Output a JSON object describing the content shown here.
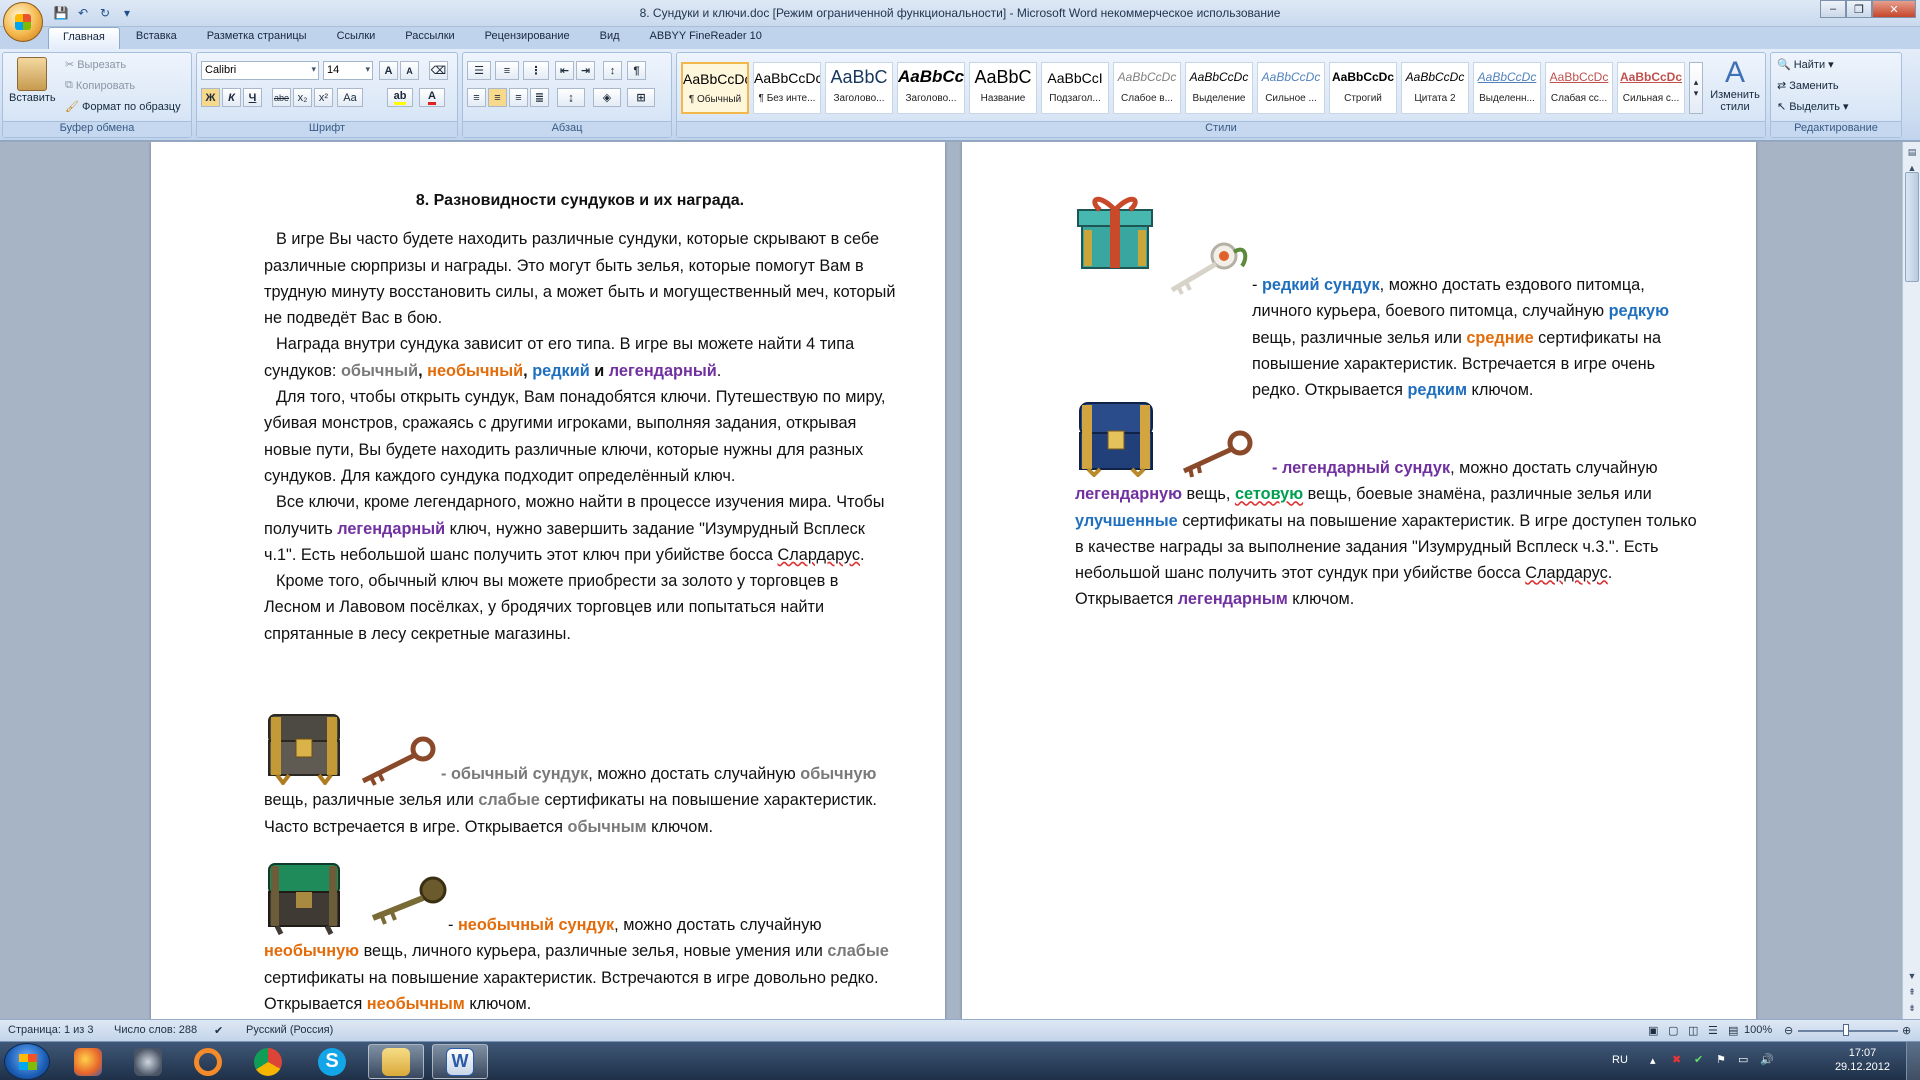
{
  "window": {
    "title": "8. Сундуки и ключи.doc [Режим ограниченной функциональности] - Microsoft Word некоммерческое использование"
  },
  "tabs": [
    "Главная",
    "Вставка",
    "Разметка страницы",
    "Ссылки",
    "Рассылки",
    "Рецензирование",
    "Вид",
    "ABBYY FineReader 10"
  ],
  "ribbon": {
    "clipboard": {
      "label": "Буфер обмена",
      "paste": "Вставить",
      "cut": "Вырезать",
      "copy": "Копировать",
      "format_painter": "Формат по образцу"
    },
    "font": {
      "label": "Шрифт",
      "family": "Calibri",
      "size": "14",
      "bold": "Ж",
      "italic": "К",
      "underline": "Ч",
      "strike": "abe",
      "sub": "x₂",
      "sup": "x²",
      "case": "Aa",
      "grow": "A",
      "shrink": "A"
    },
    "paragraph": {
      "label": "Абзац"
    },
    "styles": {
      "label": "Стили",
      "items": [
        {
          "sample": "AaBbCcDc",
          "name": "¶ Обычный"
        },
        {
          "sample": "AaBbCcDc",
          "name": "¶ Без инте..."
        },
        {
          "sample": "AaBbC",
          "name": "Заголово..."
        },
        {
          "sample": "AaBbCc",
          "name": "Заголово..."
        },
        {
          "sample": "AaBbC",
          "name": "Название"
        },
        {
          "sample": "AaBbCcI",
          "name": "Подзагол..."
        },
        {
          "sample": "AaBbCcDc",
          "name": "Слабое в..."
        },
        {
          "sample": "AaBbCcDc",
          "name": "Выделение"
        },
        {
          "sample": "AaBbCcDc",
          "name": "Сильное ..."
        },
        {
          "sample": "AaBbCcDc",
          "name": "Строгий"
        },
        {
          "sample": "AaBbCcDc",
          "name": "Цитата 2"
        },
        {
          "sample": "AaBbCcDc",
          "name": "Выделенн..."
        },
        {
          "sample": "AaBbCcDc",
          "name": "Слабая сс..."
        },
        {
          "sample": "AaBbCcDc",
          "name": "Сильная с..."
        }
      ],
      "change_styles": "Изменить стили"
    },
    "editing": {
      "label": "Редактирование",
      "find": "Найти",
      "replace": "Заменить",
      "select": "Выделить"
    }
  },
  "doc": {
    "heading": "8. Разновидности сундуков и их награда.",
    "p1": "В игре Вы часто будете находить различные сундуки, которые скрывают в себе различные сюрпризы и награды. Это могут быть зелья, которые помогут Вам в трудную минуту восстановить силы, а может быть и могущественный меч, который не подведёт Вас в бою.",
    "p2_pre": "Награда внутри сундука зависит от его типа. В игре вы можете найти 4 типа сундуков: ",
    "w_common": "обычный",
    "sep_comma": ", ",
    "w_uncommon": "необычный",
    "w_rare": "редкий",
    "and_word": " и ",
    "w_legend": "легендарный",
    "dot": ".",
    "p3": "Для того, чтобы открыть сундук, Вам понадобятся ключи. Путешествую по миру, убивая монстров, сражаясь с другими игроками, выполняя задания, открывая новые пути, Вы будете находить различные ключи, которые нужны для разных сундуков. Для каждого сундука подходит определённый ключ.",
    "p4_a": "Все ключи, кроме легендарного, можно найти в процессе изучения мира. Чтобы получить ",
    "p4_b": " ключ, нужно завершить задание \"Изумрудный Всплеск ч.1\". Есть небольшой шанс получить этот ключ при убийстве босса ",
    "boss": "Слардарус",
    "p5": "Кроме того, обычный ключ вы можете приобрести за золото у торговцев в Лесном и Лавовом посёлках, у бродячих торговцев или попытаться найти спрятанные в лесу секретные магазины.",
    "common": {
      "dash": "- ",
      "name": "обычный сундук",
      "t1": ", можно достать случайную ",
      "w1": "обычную",
      "t2": " вещь, различные зелья или ",
      "w2": "слабые",
      "t3": " сертификаты на повышение характеристик. Часто встречается в игре. Открывается ",
      "w3": "обычным",
      "t4": " ключом."
    },
    "uncommon": {
      "dash": "- ",
      "name": "необычный сундук",
      "t1": ", можно достать случайную ",
      "w1": "необычную",
      "t2": " вещь, личного курьера, различные зелья, новые умения или ",
      "w2": "слабые",
      "t3": " сертификаты на повышение характеристик. Встречаются в игре довольно редко. Открывается ",
      "w3": "необычным",
      "t4": " ключом."
    },
    "rare": {
      "dash": "- ",
      "name": "редкий сундук",
      "t1": ", можно достать ездового питомца, личного курьера, боевого питомца, случайную ",
      "w1": "редкую",
      "t2": " вещь, различные зелья или ",
      "w2": "средние",
      "t3": " сертификаты на повышение характеристик. Встречается в игре очень редко. Открывается ",
      "w3": "редким",
      "t4": " ключом."
    },
    "legend": {
      "dash": "- ",
      "name": "легендарный сундук",
      "t1": ", можно достать случайную ",
      "w1": "легендарную",
      "t2": " вещь, ",
      "w2": "сетовую",
      "t3": " вещь, боевые знамёна, различные зелья или ",
      "w3": "улучшенные",
      "t4": " сертификаты на повышение характеристик. В игре доступен только в качестве награды за выполнение задания \"Изумрудный Всплеск ч.3.\". Есть небольшой шанс получить этот сундук при убийстве босса ",
      "boss": "Слардарус",
      "t5": ". Открывается ",
      "w4": "легендарным",
      "t6": " ключом."
    }
  },
  "status": {
    "page": "Страница: 1 из 3",
    "words": "Число слов: 288",
    "lang": "Русский (Россия)",
    "zoom": "100%"
  },
  "taskbar": {
    "lang": "RU",
    "time": "17:07",
    "date": "29.12.2012"
  },
  "colors": {
    "common": "#7a7a7a",
    "uncommon": "#e36c0a",
    "rare": "#1f6fbe",
    "legend": "#7030a0",
    "set": "#00a050"
  }
}
